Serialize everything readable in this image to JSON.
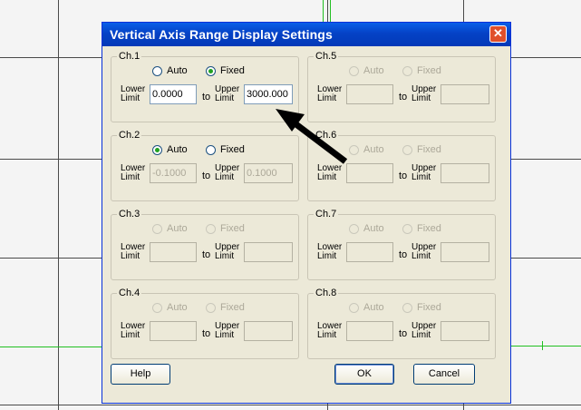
{
  "dialog": {
    "title": "Vertical Axis Range Display Settings",
    "close_glyph": "✕"
  },
  "labels": {
    "auto": "Auto",
    "fixed": "Fixed",
    "lower1": "Lower",
    "lower2": "Limit",
    "to": "to",
    "upper1": "Upper",
    "upper2": "Limit"
  },
  "channels": [
    {
      "name": "Ch.1",
      "mode": "Fixed",
      "enabled": true,
      "lower": "0.0000",
      "upper": "3000.000"
    },
    {
      "name": "Ch.2",
      "mode": "Auto",
      "enabled": true,
      "lower": "-0.1000",
      "upper": "0.1000"
    },
    {
      "name": "Ch.3",
      "mode": "",
      "enabled": false,
      "lower": "",
      "upper": ""
    },
    {
      "name": "Ch.4",
      "mode": "",
      "enabled": false,
      "lower": "",
      "upper": ""
    },
    {
      "name": "Ch.5",
      "mode": "",
      "enabled": false,
      "lower": "",
      "upper": ""
    },
    {
      "name": "Ch.6",
      "mode": "",
      "enabled": false,
      "lower": "",
      "upper": ""
    },
    {
      "name": "Ch.7",
      "mode": "",
      "enabled": false,
      "lower": "",
      "upper": ""
    },
    {
      "name": "Ch.8",
      "mode": "",
      "enabled": false,
      "lower": "",
      "upper": ""
    }
  ],
  "buttons": {
    "help": "Help",
    "ok": "OK",
    "cancel": "Cancel"
  },
  "colors": {
    "titlebar": "#0542c6",
    "dialog_bg": "#ece9d8",
    "annotation_arrow": "#000000",
    "trace": "#22c022"
  },
  "icons": {
    "close": "close-icon",
    "annotation": "arrow-annotation-icon"
  }
}
